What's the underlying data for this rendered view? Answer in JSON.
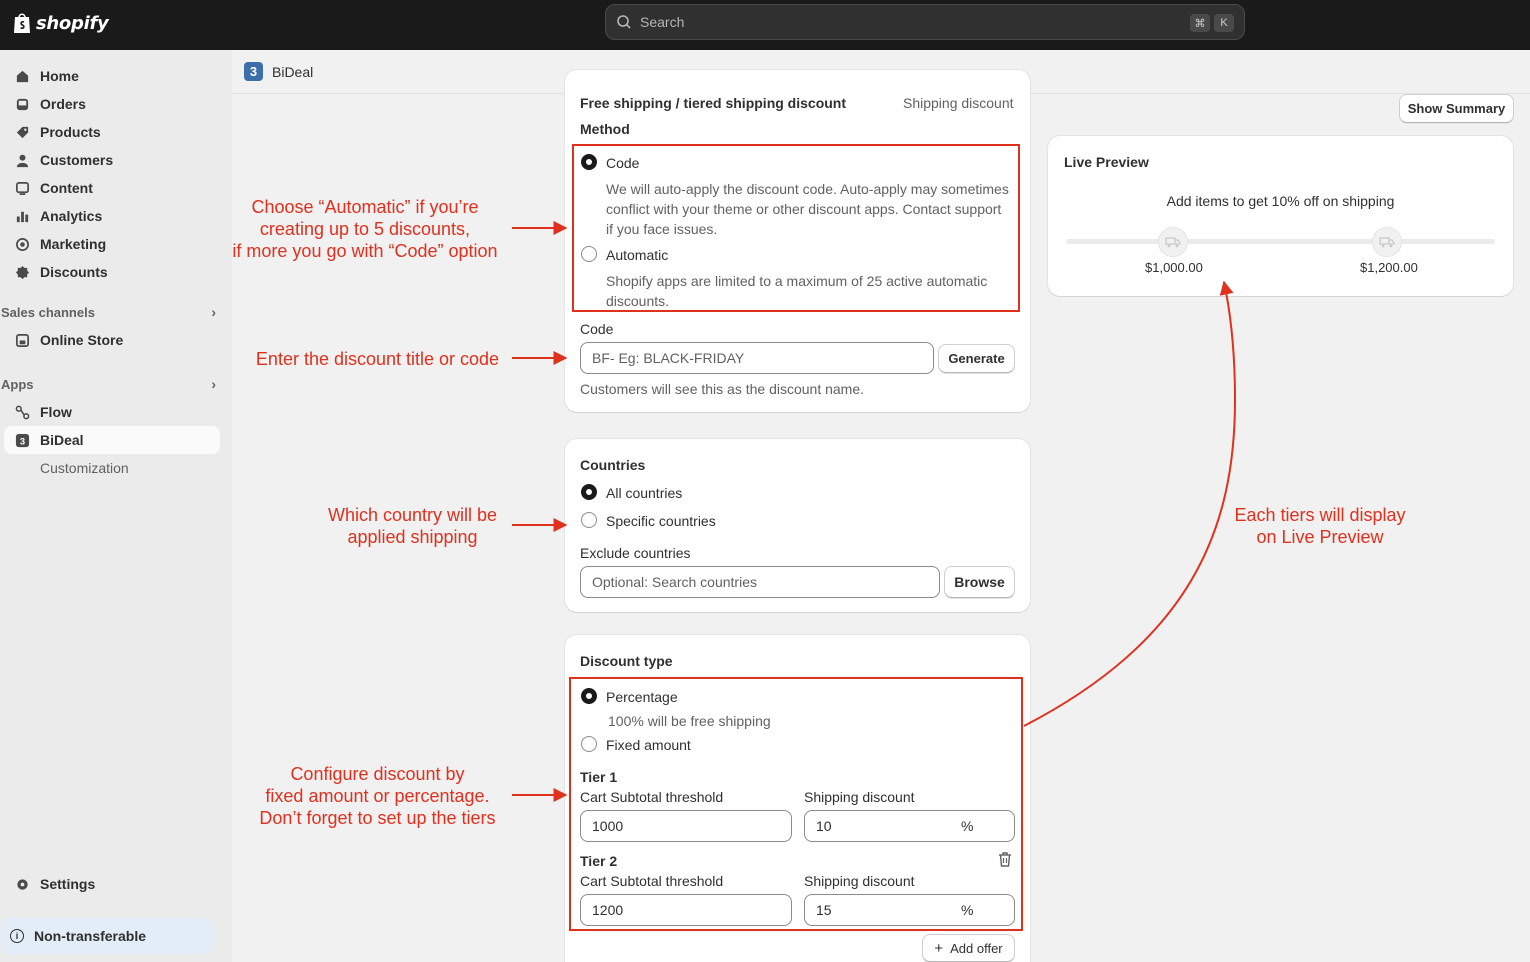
{
  "topbar": {
    "brand": "shopify",
    "search_placeholder": "Search",
    "kbd_cmd": "⌘",
    "kbd_k": "K"
  },
  "sidebar": {
    "items": [
      {
        "label": "Home",
        "icon": "home-icon"
      },
      {
        "label": "Orders",
        "icon": "inbox-icon"
      },
      {
        "label": "Products",
        "icon": "tag-icon"
      },
      {
        "label": "Customers",
        "icon": "person-icon"
      },
      {
        "label": "Content",
        "icon": "content-icon"
      },
      {
        "label": "Analytics",
        "icon": "bar-chart-icon"
      },
      {
        "label": "Marketing",
        "icon": "target-icon"
      },
      {
        "label": "Discounts",
        "icon": "discount-icon"
      }
    ],
    "sales_channels_heading": "Sales channels",
    "online_store": "Online Store",
    "apps_heading": "Apps",
    "flow": "Flow",
    "bideal": "BiDeal",
    "customization": "Customization",
    "settings": "Settings",
    "non_transferable": "Non-transferable"
  },
  "app_header": {
    "logo_letter": "3",
    "title": "BiDeal"
  },
  "method_card": {
    "title": "Free shipping / tiered shipping discount",
    "subtitle": "Shipping discount",
    "method_label": "Method",
    "code_option": "Code",
    "code_help_1": "We will auto-apply the discount code. Auto-apply may sometimes",
    "code_help_2": "conflict with your theme or other discount apps. Contact support",
    "code_help_3": "if you face issues.",
    "automatic_option": "Automatic",
    "automatic_help_1": "Shopify apps are limited to a maximum of 25 active automatic",
    "automatic_help_2": "discounts.",
    "code_field_label": "Code",
    "code_placeholder": "BF-  Eg: BLACK-FRIDAY",
    "generate_button": "Generate",
    "code_help_footer": "Customers will see this as the discount name."
  },
  "countries_card": {
    "title": "Countries",
    "all_countries": "All countries",
    "specific_countries": "Specific countries",
    "exclude_label": "Exclude countries",
    "exclude_placeholder": "Optional:  Search countries",
    "browse_button": "Browse"
  },
  "discount_card": {
    "title": "Discount type",
    "percentage": "Percentage",
    "percentage_help": "100% will be free shipping",
    "fixed_amount": "Fixed amount",
    "tiers": [
      {
        "name": "Tier 1",
        "threshold_label": "Cart Subtotal threshold",
        "threshold": "1000",
        "discount_label": "Shipping discount",
        "discount": "10",
        "unit": "%"
      },
      {
        "name": "Tier 2",
        "threshold_label": "Cart Subtotal threshold",
        "threshold": "1200",
        "discount_label": "Shipping discount",
        "discount": "15",
        "unit": "%"
      }
    ],
    "add_offer": "Add offer"
  },
  "show_summary": "Show Summary",
  "live_preview": {
    "title": "Live Preview",
    "message": "Add items to get 10% off on shipping",
    "tier_labels": [
      "$1,000.00",
      "$1,200.00"
    ]
  },
  "annotations": {
    "method_1": "Choose “Automatic” if you’re",
    "method_2": "creating up to 5 discounts,",
    "method_3": "if more you go with “Code” option",
    "code": "Enter the discount title or code",
    "country_1": "Which country will be",
    "country_2": "applied shipping",
    "discount_1": "Configure discount by",
    "discount_2": "fixed amount or percentage.",
    "discount_3": "Don’t forget to set up the tiers",
    "preview_1": "Each tiers will display",
    "preview_2": "on Live Preview",
    "color": "#e0301e"
  }
}
